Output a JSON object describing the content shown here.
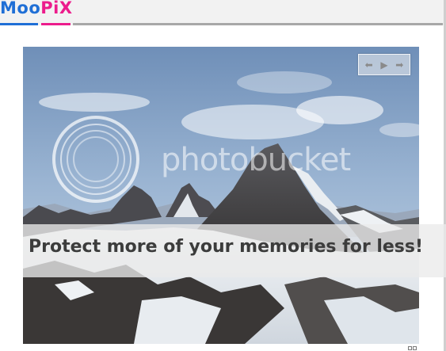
{
  "header": {
    "logo_part1": "Moo",
    "logo_part2": "PiX"
  },
  "slideshow": {
    "nav": {
      "prev_icon": "arrow-left-icon",
      "play_icon": "play-icon",
      "next_icon": "arrow-right-icon"
    },
    "watermark_text": "photobucket",
    "banner_text": "Protect more of your memories for less!"
  },
  "colors": {
    "logo_blue": "#1f6fd6",
    "logo_pink": "#ec1c8c",
    "rule_gray": "#a8a8a8"
  }
}
